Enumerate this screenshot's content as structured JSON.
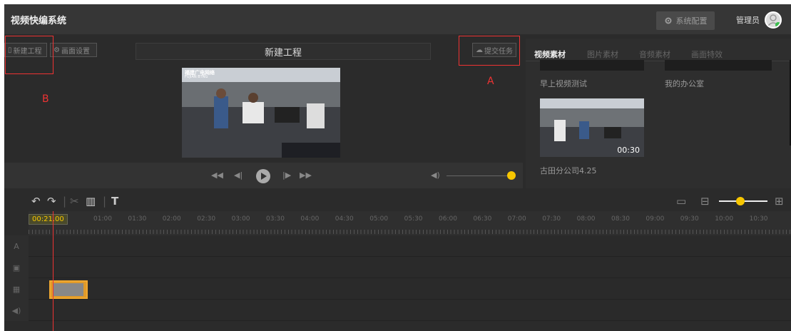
{
  "header": {
    "app_title": "视频快编系统",
    "settings_label": "系统配置",
    "admin_label": "管理员"
  },
  "editor": {
    "new_project_button": "新建工程",
    "canvas_settings_button": "画面设置",
    "project_title": "新建工程",
    "submit_task_button": "提交任务"
  },
  "annotations": {
    "a": "A",
    "b": "B"
  },
  "preview": {
    "logo_text": "福建广电网络",
    "logo_subtext": "FUJIAN BTNG"
  },
  "assets": {
    "tabs": [
      "视频素材",
      "图片素材",
      "音频素材",
      "画面特效"
    ],
    "active_tab": 0,
    "items": [
      {
        "label": "早上视频测试"
      },
      {
        "label": "我的办公室"
      },
      {
        "label": "古田分公司4.25",
        "duration": "00:30"
      }
    ]
  },
  "timeline": {
    "current_time": "00:21.00",
    "ruler_labels": [
      "01:00",
      "01:30",
      "02:00",
      "02:30",
      "03:00",
      "03:30",
      "04:00",
      "04:30",
      "05:00",
      "05:30",
      "06:00",
      "06:30",
      "07:00",
      "07:30",
      "08:00",
      "08:30",
      "09:00",
      "09:30",
      "10:00",
      "10:30"
    ],
    "tracks": [
      "A",
      "image",
      "film",
      "audio"
    ]
  },
  "colors": {
    "accent": "#f7c600",
    "annotation": "#ee3333",
    "clip": "#e09a2a"
  }
}
